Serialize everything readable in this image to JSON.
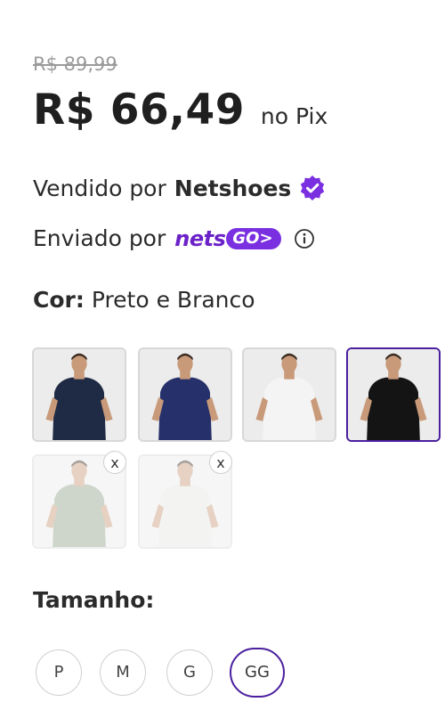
{
  "pricing": {
    "old_price": "R$ 89,99",
    "price": "R$ 66,49",
    "price_suffix": "no Pix"
  },
  "seller": {
    "prefix": "Vendido por",
    "name": "Netshoes",
    "verified_icon": "verified-badge-icon"
  },
  "shipping": {
    "prefix": "Enviado por",
    "brand_text": "nets",
    "brand_pill": "GO>",
    "info_icon": "info-icon"
  },
  "color": {
    "label": "Cor:",
    "value": "Preto e Branco",
    "options": [
      {
        "name": "navy-tshirt-1",
        "shirt": "#1f2a44",
        "selected": false,
        "available": true
      },
      {
        "name": "navy-tshirt-2",
        "shirt": "#26306a",
        "selected": false,
        "available": true
      },
      {
        "name": "white-tshirt",
        "shirt": "#f4f4f4",
        "selected": false,
        "available": true
      },
      {
        "name": "black-tshirt",
        "shirt": "#141414",
        "selected": true,
        "available": true
      },
      {
        "name": "green-tshirt",
        "shirt": "#93a58e",
        "selected": false,
        "available": false,
        "badge": "x"
      },
      {
        "name": "offwhite-tshirt",
        "shirt": "#e6e6e2",
        "selected": false,
        "available": false,
        "badge": "x"
      }
    ]
  },
  "size": {
    "label": "Tamanho:",
    "options": [
      {
        "label": "P",
        "selected": false
      },
      {
        "label": "M",
        "selected": false
      },
      {
        "label": "G",
        "selected": false
      },
      {
        "label": "GG",
        "selected": true
      }
    ]
  },
  "colors": {
    "accent": "#4b1f9e",
    "brand_purple": "#7a2fe0"
  }
}
